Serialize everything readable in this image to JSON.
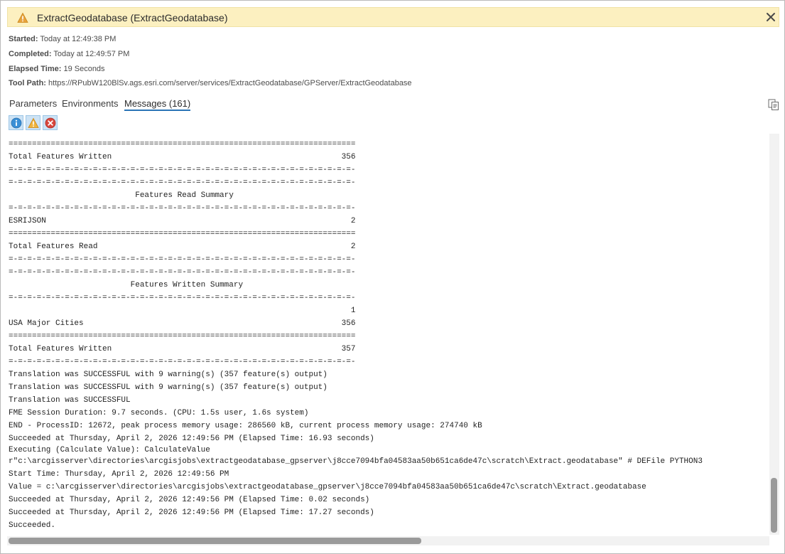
{
  "dialog": {
    "title": "ExtractGeodatabase (ExtractGeodatabase)",
    "accent_warning": "#e8a33d",
    "banner_bg": "#fcf0c0"
  },
  "meta": {
    "started_label": "Started:",
    "started_value": "Today at 12:49:38 PM",
    "completed_label": "Completed:",
    "completed_value": "Today at 12:49:57 PM",
    "elapsed_label": "Elapsed Time:",
    "elapsed_value": "19 Seconds",
    "toolpath_label": "Tool Path:",
    "toolpath_value": "https://RPubW120BlSv.ags.esri.com/server/services/ExtractGeodatabase/GPServer/ExtractGeodatabase"
  },
  "tabs": {
    "parameters": "Parameters",
    "environments": "Environments",
    "messages": "Messages (161)",
    "active_color": "#2a74b6"
  },
  "filters": {
    "info_icon": "info-icon",
    "warning_icon": "warning-icon",
    "error_icon": "error-icon"
  },
  "log": {
    "lines": [
      "==========================================================================",
      "Total Features Written                                                 356",
      "=-=-=-=-=-=-=-=-=-=-=-=-=-=-=-=-=-=-=-=-=-=-=-=-=-=-=-=-=-=-=-=-=-=-=-=-=-",
      "=-=-=-=-=-=-=-=-=-=-=-=-=-=-=-=-=-=-=-=-=-=-=-=-=-=-=-=-=-=-=-=-=-=-=-=-=-",
      "                           Features Read Summary",
      "=-=-=-=-=-=-=-=-=-=-=-=-=-=-=-=-=-=-=-=-=-=-=-=-=-=-=-=-=-=-=-=-=-=-=-=-=-",
      "ESRIJSON                                                                 2",
      "==========================================================================",
      "Total Features Read                                                      2",
      "=-=-=-=-=-=-=-=-=-=-=-=-=-=-=-=-=-=-=-=-=-=-=-=-=-=-=-=-=-=-=-=-=-=-=-=-=-",
      "=-=-=-=-=-=-=-=-=-=-=-=-=-=-=-=-=-=-=-=-=-=-=-=-=-=-=-=-=-=-=-=-=-=-=-=-=-",
      "                          Features Written Summary",
      "=-=-=-=-=-=-=-=-=-=-=-=-=-=-=-=-=-=-=-=-=-=-=-=-=-=-=-=-=-=-=-=-=-=-=-=-=-",
      "                                                                         1",
      "USA Major Cities                                                       356",
      "==========================================================================",
      "Total Features Written                                                 357",
      "=-=-=-=-=-=-=-=-=-=-=-=-=-=-=-=-=-=-=-=-=-=-=-=-=-=-=-=-=-=-=-=-=-=-=-=-=-",
      "Translation was SUCCESSFUL with 9 warning(s) (357 feature(s) output)",
      "Translation was SUCCESSFUL with 9 warning(s) (357 feature(s) output)",
      "Translation was SUCCESSFUL",
      "FME Session Duration: 9.7 seconds. (CPU: 1.5s user, 1.6s system)",
      "END - ProcessID: 12672, peak process memory usage: 286560 kB, current process memory usage: 274740 kB",
      "Succeeded at Thursday, April 2, 2026 12:49:56 PM (Elapsed Time: 16.93 seconds)",
      "Executing (Calculate Value): CalculateValue",
      "r\"c:\\arcgisserver\\directories\\arcgisjobs\\extractgeodatabase_gpserver\\j8cce7094bfa04583aa50b651ca6de47c\\scratch\\Extract.geodatabase\" # DEFile PYTHON3",
      "Start Time: Thursday, April 2, 2026 12:49:56 PM",
      "Value = c:\\arcgisserver\\directories\\arcgisjobs\\extractgeodatabase_gpserver\\j8cce7094bfa04583aa50b651ca6de47c\\scratch\\Extract.geodatabase",
      "Succeeded at Thursday, April 2, 2026 12:49:56 PM (Elapsed Time: 0.02 seconds)",
      "Succeeded at Thursday, April 2, 2026 12:49:56 PM (Elapsed Time: 17.27 seconds)",
      "Succeeded."
    ]
  }
}
